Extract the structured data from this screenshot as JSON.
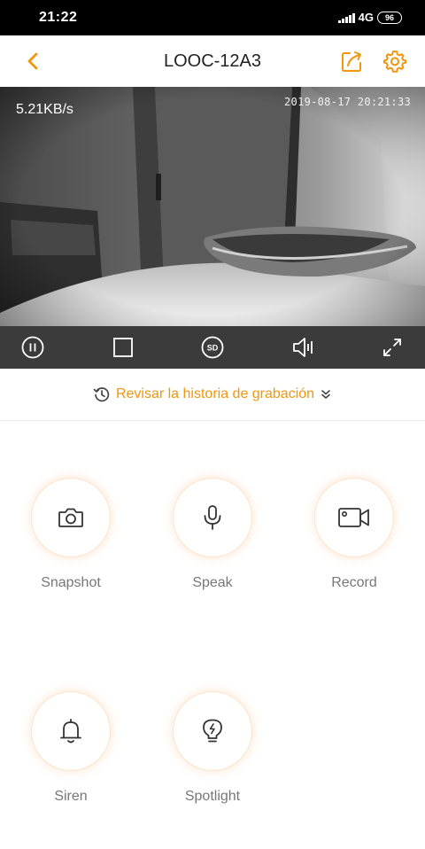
{
  "status_bar": {
    "time": "21:22",
    "network": "4G",
    "battery": "96"
  },
  "header": {
    "title": "LOOC-12A3"
  },
  "video": {
    "bitrate": "5.21KB/s",
    "timestamp": "2019-08-17 20:21:33"
  },
  "controls": {
    "sd_label": "SD"
  },
  "history": {
    "label": "Revisar la historia de grabación"
  },
  "actions": [
    {
      "label": "Snapshot",
      "icon": "camera-icon"
    },
    {
      "label": "Speak",
      "icon": "microphone-icon"
    },
    {
      "label": "Record",
      "icon": "video-camera-icon"
    },
    {
      "label": "Siren",
      "icon": "bell-icon"
    },
    {
      "label": "Spotlight",
      "icon": "lightbulb-icon"
    }
  ],
  "colors": {
    "accent": "#f0960f",
    "control_bar": "#3b3b3b",
    "status_bar": "#000000"
  }
}
